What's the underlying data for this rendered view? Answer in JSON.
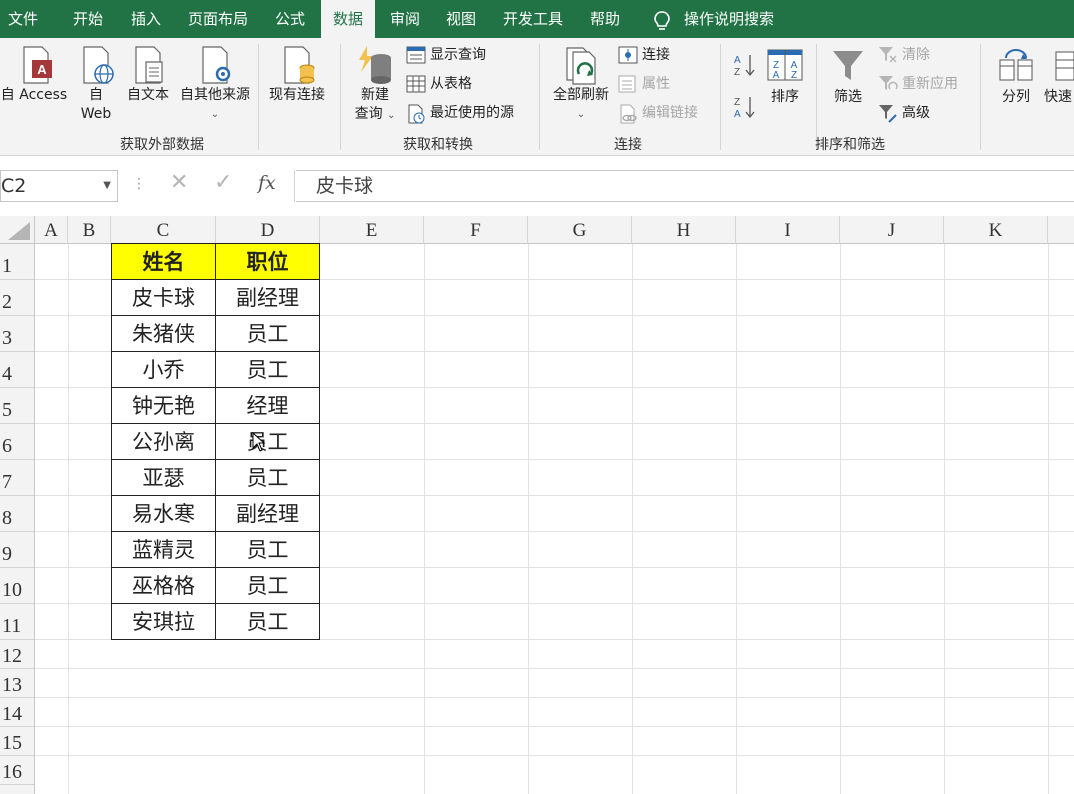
{
  "tabs": [
    "文件",
    "开始",
    "插入",
    "页面布局",
    "公式",
    "数据",
    "审阅",
    "视图",
    "开发工具",
    "帮助"
  ],
  "active_tab": "数据",
  "search_label": "操作说明搜索",
  "ribbon": {
    "get_external": {
      "label": "获取外部数据",
      "from_access": "自 Access",
      "from_web_1": "自",
      "from_web_2": "Web",
      "from_text": "自文本",
      "from_other": "自其他来源",
      "existing": "现有连接"
    },
    "get_transform": {
      "label": "获取和转换",
      "new_query_1": "新建",
      "new_query_2": "查询",
      "show_queries": "显示查询",
      "from_table": "从表格",
      "recent_sources": "最近使用的源"
    },
    "connections": {
      "label": "连接",
      "refresh_all": "全部刷新",
      "connections": "连接",
      "properties": "属性",
      "edit_links": "编辑链接"
    },
    "sort_filter": {
      "label": "排序和筛选",
      "sort": "排序",
      "filter": "筛选",
      "clear": "清除",
      "reapply": "重新应用",
      "advanced": "高级"
    },
    "data_tools": {
      "text_to_columns": "分列",
      "flash_fill": "快速"
    }
  },
  "formula_bar": {
    "name_box": "C2",
    "fx": "fx",
    "content": "皮卡球"
  },
  "columns": [
    "A",
    "B",
    "C",
    "D",
    "E",
    "F",
    "G",
    "H",
    "I",
    "J",
    "K"
  ],
  "rows": [
    "1",
    "2",
    "3",
    "4",
    "5",
    "6",
    "7",
    "8",
    "9",
    "10",
    "11",
    "12",
    "13",
    "14",
    "15",
    "16"
  ],
  "table": {
    "headers": [
      "姓名",
      "职位"
    ],
    "rows": [
      [
        "皮卡球",
        "副经理"
      ],
      [
        "朱猪侠",
        "员工"
      ],
      [
        "小乔",
        "员工"
      ],
      [
        "钟无艳",
        "经理"
      ],
      [
        "公孙离",
        "员工"
      ],
      [
        "亚瑟",
        "员工"
      ],
      [
        "易水寒",
        "副经理"
      ],
      [
        "蓝精灵",
        "员工"
      ],
      [
        "巫格格",
        "员工"
      ],
      [
        "安琪拉",
        "员工"
      ]
    ]
  },
  "colors": {
    "brand": "#217346",
    "header_fill": "#ffff00"
  }
}
